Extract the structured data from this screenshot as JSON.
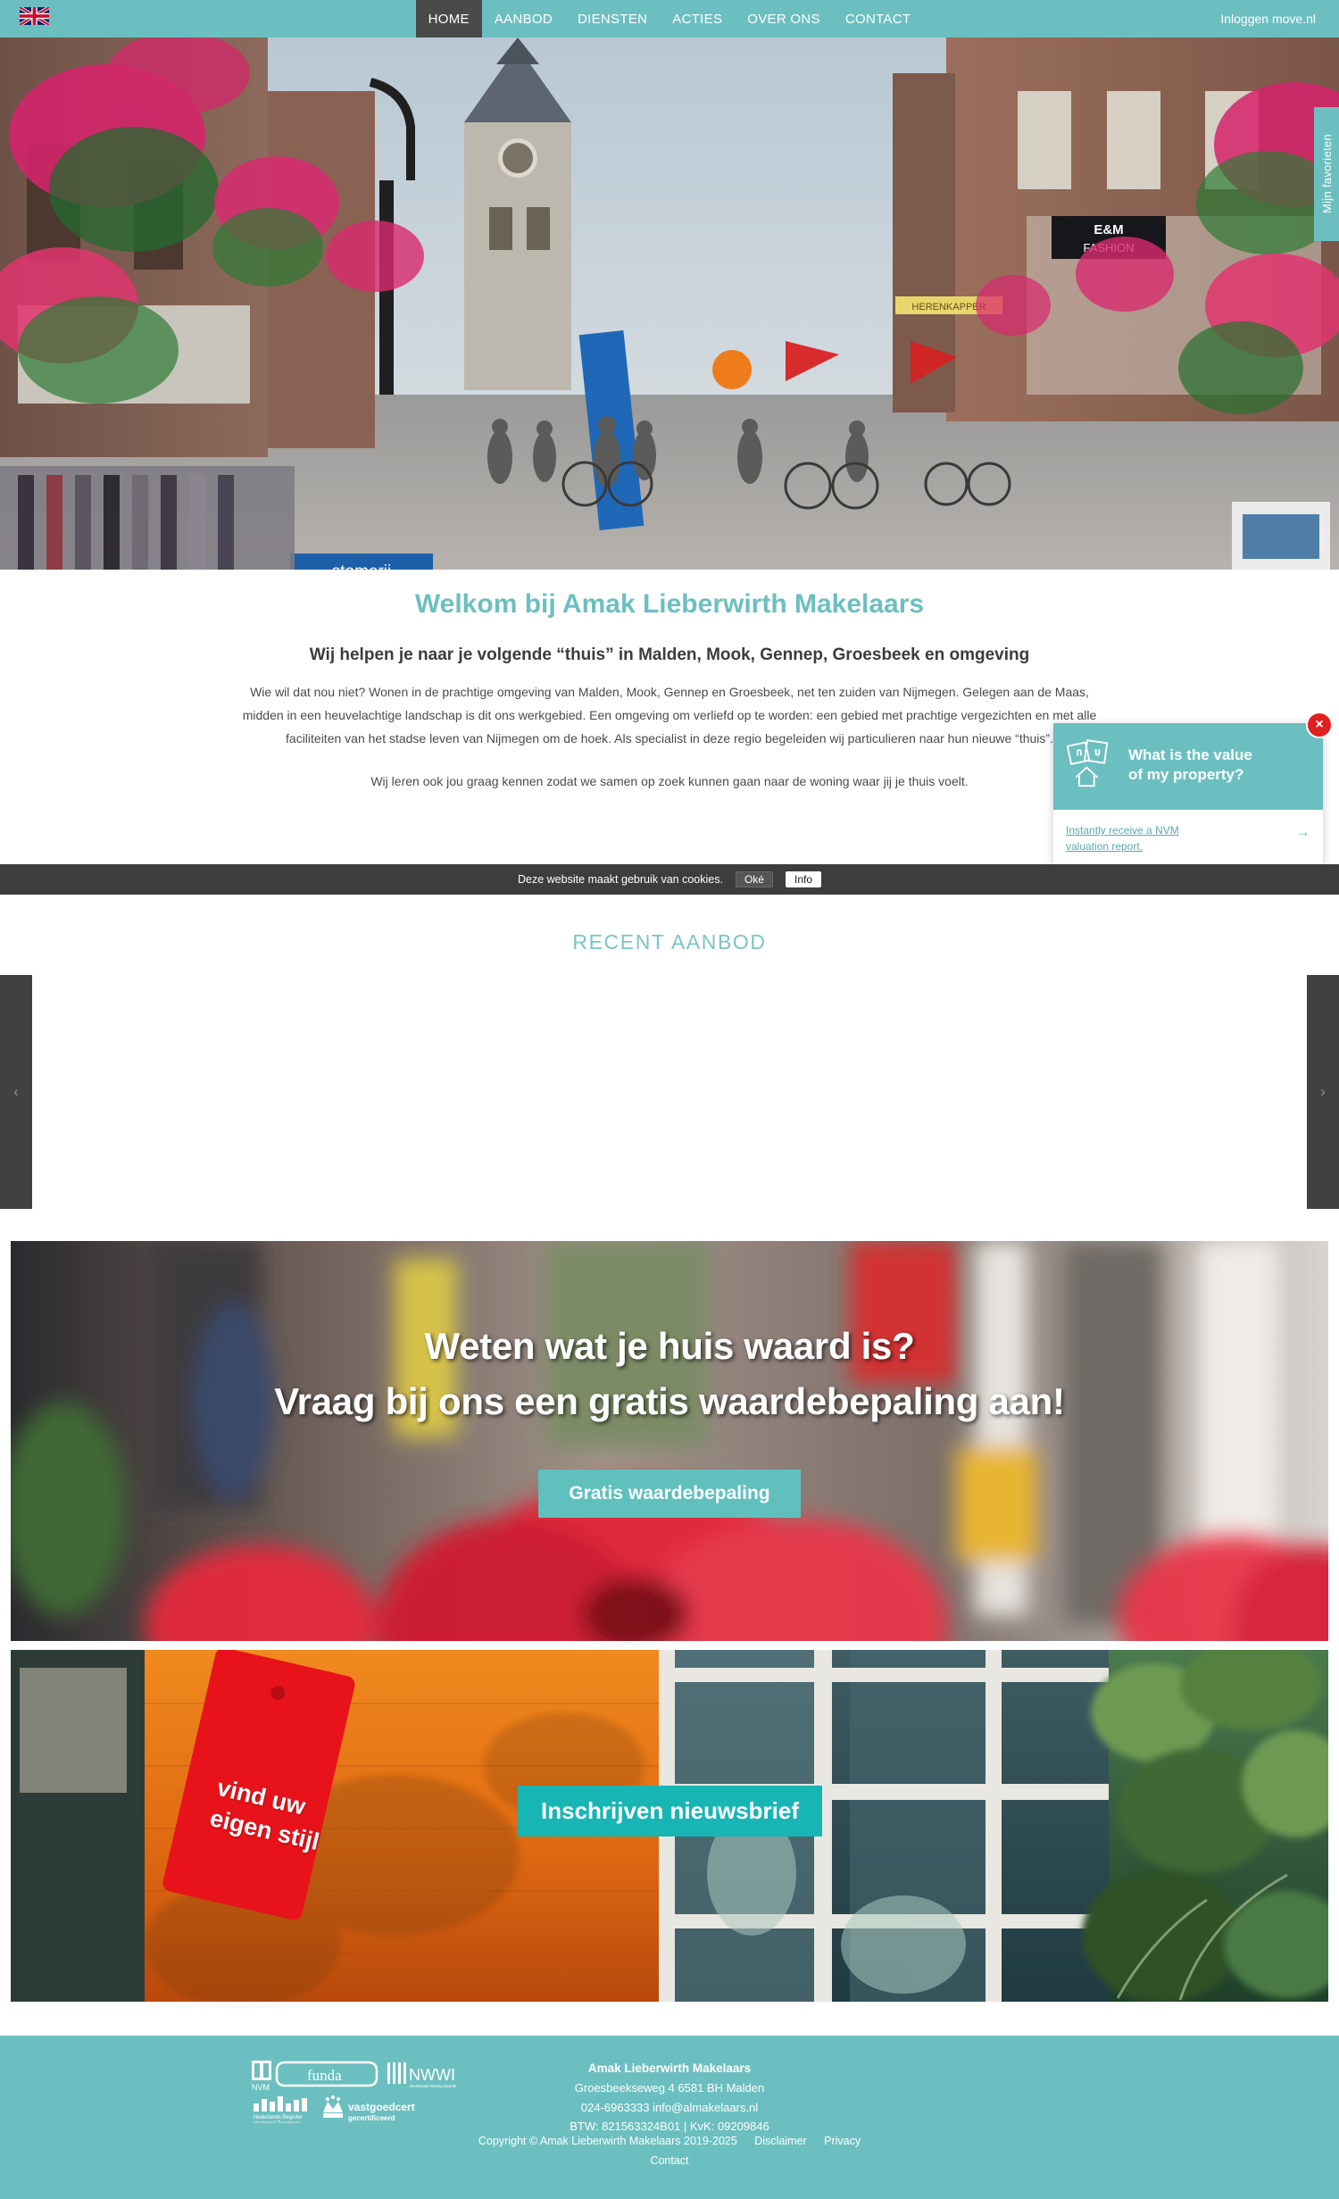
{
  "nav": {
    "flag_icon": "uk-flag-icon",
    "items": [
      {
        "label": "HOME",
        "active": true
      },
      {
        "label": "AANBOD",
        "active": false
      },
      {
        "label": "DIENSTEN",
        "active": false
      },
      {
        "label": "ACTIES",
        "active": false
      },
      {
        "label": "OVER ONS",
        "active": false
      },
      {
        "label": "CONTACT",
        "active": false
      }
    ],
    "login_label": "Inloggen move.nl"
  },
  "hero": {
    "favorites_tab_label": "Mijn favorieten",
    "image_description": "Dutch village shopping street with hanging flower baskets and a church tower"
  },
  "welcome": {
    "heading": "Welkom bij Amak Lieberwirth Makelaars",
    "subheading": "Wij helpen je naar je volgende “thuis” in Malden, Mook, Gennep, Groesbeek en omgeving",
    "paragraph1": "Wie wil dat nou niet? Wonen in de prachtige omgeving van Malden, Mook, Gennep en Groesbeek, net ten zuiden van Nijmegen. Gelegen aan de Maas, midden in een heuvelachtige landschap is dit ons werkgebied. Een omgeving om verliefd op te worden: een gebied met prachtige vergezichten en met alle faciliteiten van het stadse leven van Nijmegen om de hoek. Als specialist in deze regio begeleiden wij particulieren naar hun nieuwe “thuis”.",
    "paragraph2": "Wij leren ook jou graag kennen zodat we samen op zoek kunnen gaan naar de woning waar jij je thuis voelt."
  },
  "popup": {
    "title": "What is the value\nof my property?",
    "link": "Instantly receive a NVM\nvaluation report.",
    "arrow_icon": "arrow-right-icon",
    "close_icon": "×",
    "icon": "house-valuation-icon"
  },
  "cookiebar": {
    "message": "Deze website maakt gebruik van cookies.",
    "ok_label": "Oké",
    "info_label": "Info"
  },
  "recent": {
    "title": "RECENT AANBOD",
    "prev_icon": "‹",
    "next_icon": "›",
    "items": []
  },
  "banner1": {
    "line1": "Weten wat je huis waard is?",
    "line2": "Vraag bij ons een gratis waardebepaling aan!",
    "button_label": "Gratis waardebepaling"
  },
  "banner2": {
    "tag_text": "vind uw\neigen stijl",
    "button_label": "Inschrijven nieuwsbrief"
  },
  "footer": {
    "logos": [
      "NVM",
      "funda",
      "NWWI",
      "Nederlands Register Vastgoed Taxateurs",
      "vastgoedcert gecertificeerd"
    ],
    "company": "Amak Lieberwirth Makelaars",
    "address": "Groesbeekseweg 4   6581 BH Malden",
    "contact": "024-6963333   info@almakelaars.nl",
    "registration": "BTW: 821563324B01  |  KvK: 09209846",
    "copyright": "Copyright © Amak Lieberwirth Makelaars 2019-2025",
    "links": [
      "Disclaimer",
      "Privacy",
      "Contact"
    ]
  },
  "colors": {
    "teal": "#6cbfc0",
    "teal_light": "#7cc4c5",
    "dark": "#4a4a4a",
    "cookie_bg": "#3d3d3d",
    "red": "#e02020",
    "banner_btn": "#5fc0bd",
    "news_btn": "#18b5b5",
    "tag_red": "#e8131a"
  }
}
